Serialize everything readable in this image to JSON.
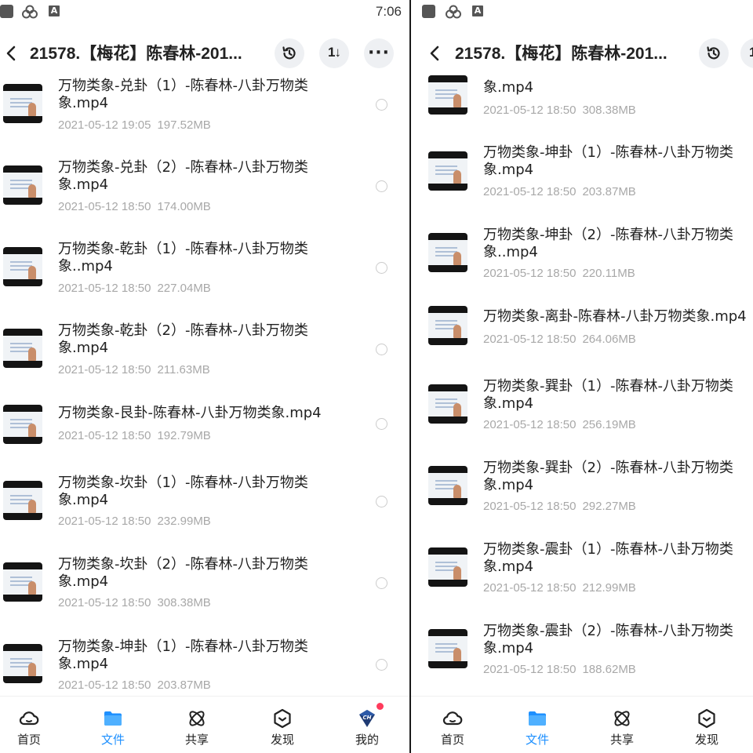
{
  "status_bar": {
    "time": "7:06"
  },
  "header": {
    "title": "21578.【梅花】陈春林-201..."
  },
  "left_files": [
    {
      "name": "万物类象-兑卦（1）-陈春林-八卦万物类象.mp4",
      "date": "2021-05-12 19:05",
      "size": "197.52MB"
    },
    {
      "name": "万物类象-兑卦（2）-陈春林-八卦万物类象.mp4",
      "date": "2021-05-12 18:50",
      "size": "174.00MB"
    },
    {
      "name": "万物类象-乾卦（1）-陈春林-八卦万物类象..mp4",
      "date": "2021-05-12 18:50",
      "size": "227.04MB"
    },
    {
      "name": "万物类象-乾卦（2）-陈春林-八卦万物类象.mp4",
      "date": "2021-05-12 18:50",
      "size": "211.63MB"
    },
    {
      "name": "万物类象-艮卦-陈春林-八卦万物类象.mp4",
      "date": "2021-05-12 18:50",
      "size": "192.79MB"
    },
    {
      "name": "万物类象-坎卦（1）-陈春林-八卦万物类象.mp4",
      "date": "2021-05-12 18:50",
      "size": "232.99MB"
    },
    {
      "name": "万物类象-坎卦（2）-陈春林-八卦万物类象.mp4",
      "date": "2021-05-12 18:50",
      "size": "308.38MB"
    },
    {
      "name": "万物类象-坤卦（1）-陈春林-八卦万物类象.mp4",
      "date": "2021-05-12 18:50",
      "size": "203.87MB"
    }
  ],
  "right_files": [
    {
      "name": "象.mp4",
      "date": "2021-05-12 18:50",
      "size": "308.38MB"
    },
    {
      "name": "万物类象-坤卦（1）-陈春林-八卦万物类象.mp4",
      "date": "2021-05-12 18:50",
      "size": "203.87MB"
    },
    {
      "name": "万物类象-坤卦（2）-陈春林-八卦万物类象..mp4",
      "date": "2021-05-12 18:50",
      "size": "220.11MB"
    },
    {
      "name": "万物类象-离卦-陈春林-八卦万物类象.mp4",
      "date": "2021-05-12 18:50",
      "size": "264.06MB"
    },
    {
      "name": "万物类象-巽卦（1）-陈春林-八卦万物类象.mp4",
      "date": "2021-05-12 18:50",
      "size": "256.19MB"
    },
    {
      "name": "万物类象-巽卦（2）-陈春林-八卦万物类象.mp4",
      "date": "2021-05-12 18:50",
      "size": "292.27MB"
    },
    {
      "name": "万物类象-震卦（1）-陈春林-八卦万物类象.mp4",
      "date": "2021-05-12 18:50",
      "size": "212.99MB"
    },
    {
      "name": "万物类象-震卦（2）-陈春林-八卦万物类象.mp4",
      "date": "2021-05-12 18:50",
      "size": "188.62MB"
    }
  ],
  "nav": {
    "items": [
      {
        "label": "首页",
        "icon": "cloud-home-icon"
      },
      {
        "label": "文件",
        "icon": "folder-icon",
        "active": true
      },
      {
        "label": "共享",
        "icon": "share-atom-icon"
      },
      {
        "label": "发现",
        "icon": "discover-hexagon-icon"
      },
      {
        "label": "我的",
        "icon": "profile-badge-icon",
        "badge": true
      }
    ],
    "profile_badge_text": "CH"
  },
  "colors": {
    "accent": "#1e90ff",
    "badge": "#ff3b5c",
    "meta_text": "#a8a8a8"
  }
}
